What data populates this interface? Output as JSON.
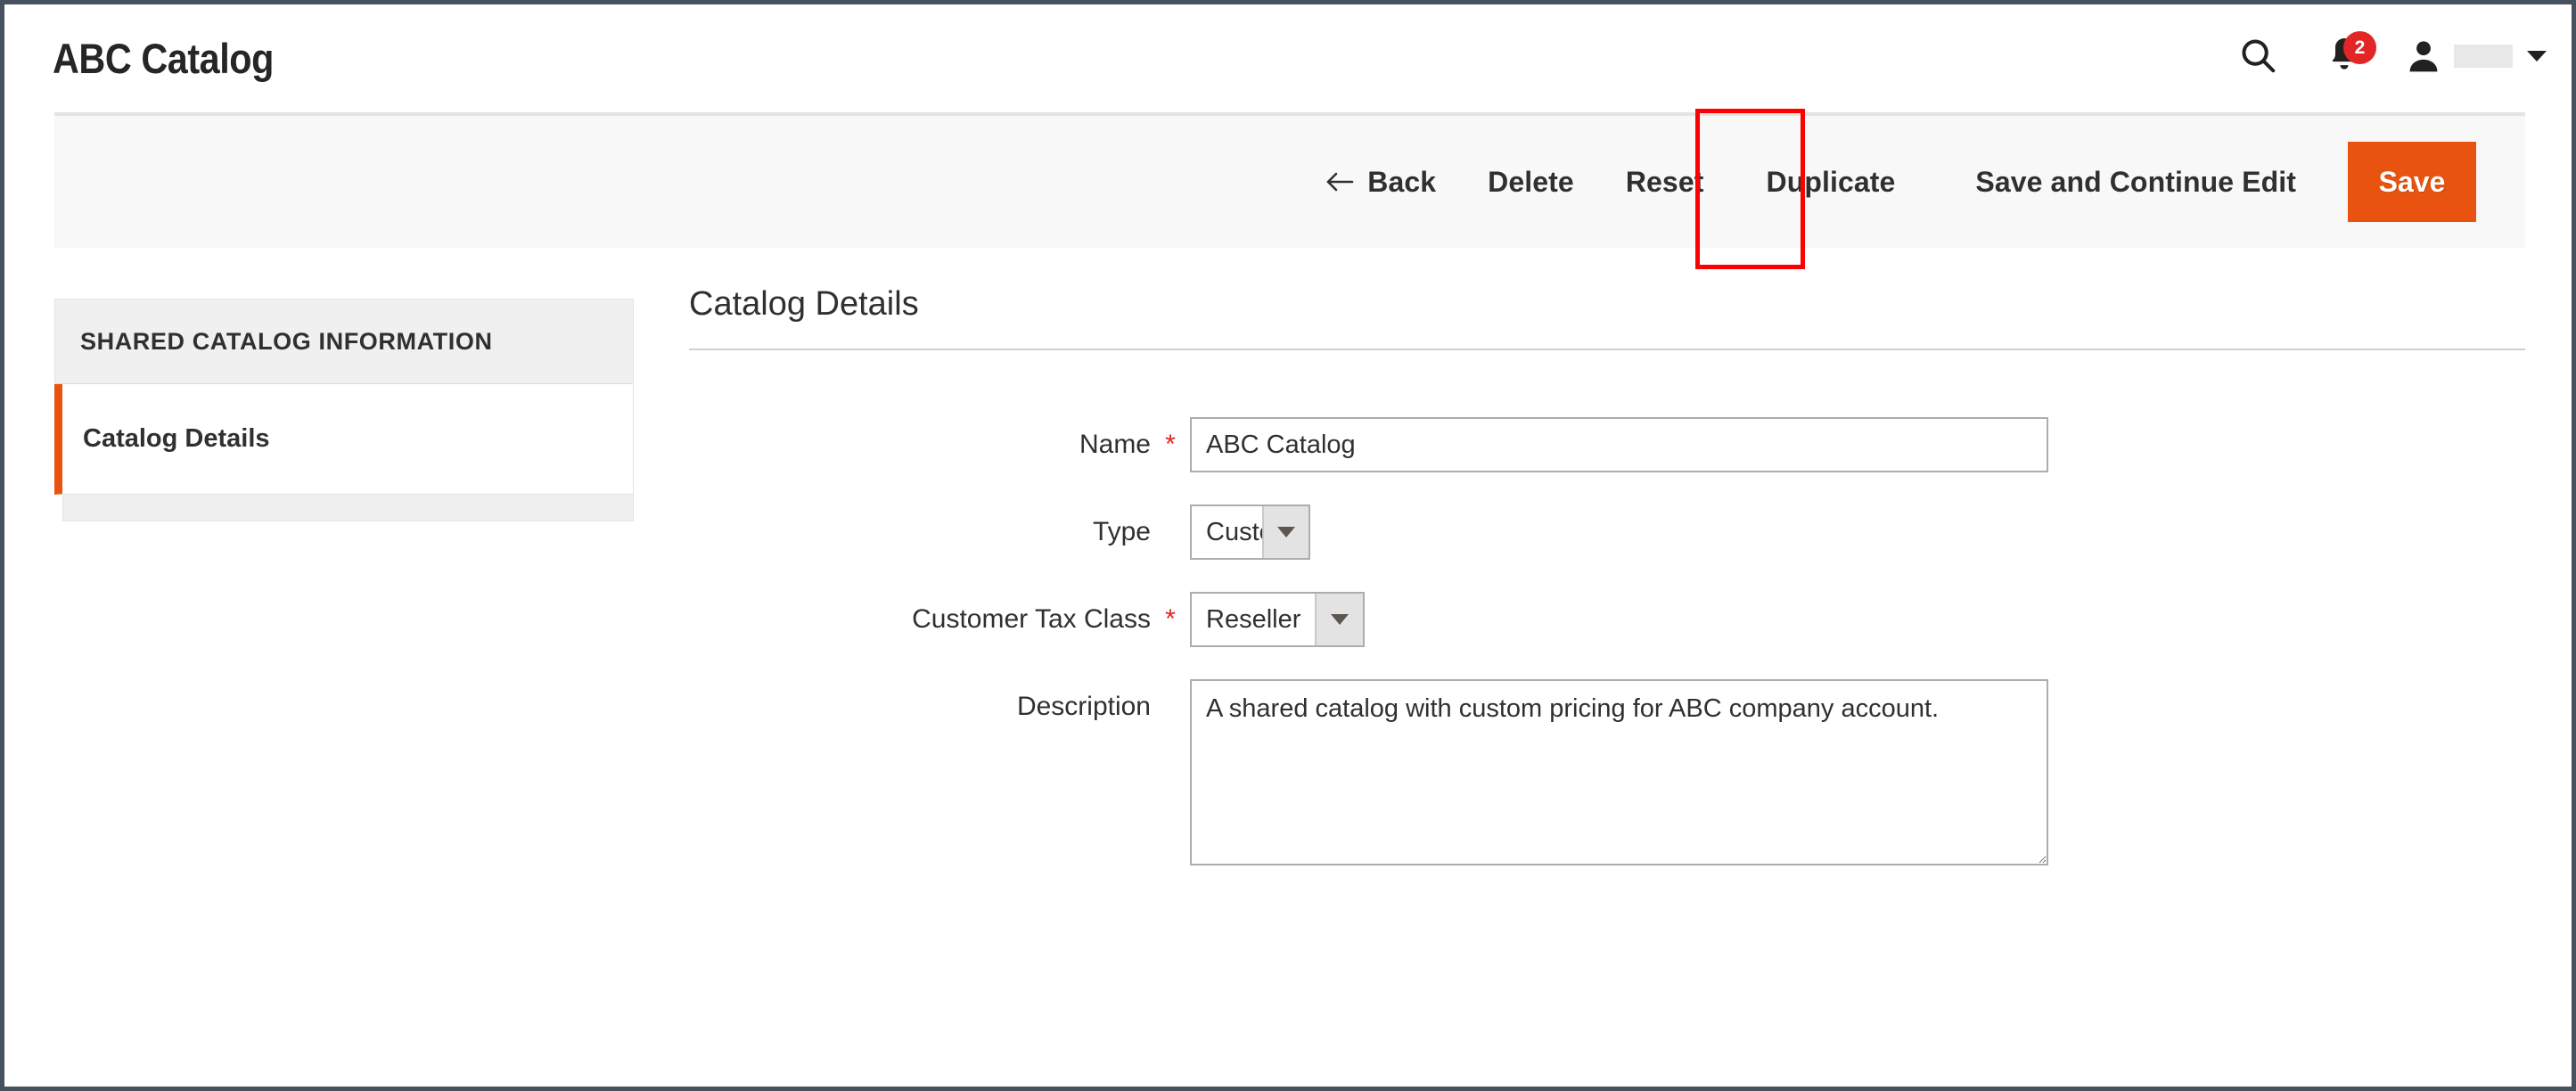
{
  "window": {
    "frame_border_color": "#46535e"
  },
  "header": {
    "page_title": "ABC Catalog",
    "search_icon": "search-icon",
    "notifications_icon": "bell-icon",
    "notifications_count": "2",
    "notifications_badge_color": "#e22626",
    "account_icon": "user-avatar-icon",
    "account_name": "",
    "account_chevron_icon": "chevron-down-icon"
  },
  "toolbar": {
    "back_label": "Back",
    "back_icon": "arrow-left-icon",
    "delete_label": "Delete",
    "reset_label": "Reset",
    "duplicate_label": "Duplicate",
    "save_and_continue_label": "Save and Continue Edit",
    "save_label": "Save",
    "save_button_color": "#e8530f",
    "highlight_target": "Duplicate",
    "highlight_color": "#ff0000"
  },
  "sidebar": {
    "section_title": "SHARED CATALOG INFORMATION",
    "items": [
      {
        "label": "Catalog Details",
        "active": true,
        "accent_color": "#e8530f"
      }
    ]
  },
  "form": {
    "heading": "Catalog Details",
    "fields": [
      {
        "label": "Name",
        "required": true,
        "required_marker": "*",
        "type": "text",
        "value": "ABC Catalog",
        "placeholder": ""
      },
      {
        "label": "Type",
        "required": false,
        "required_marker": "",
        "type": "select",
        "value": "Custom"
      },
      {
        "label": "Customer Tax Class",
        "required": true,
        "required_marker": "*",
        "type": "select",
        "value": "Reseller"
      },
      {
        "label": "Description",
        "required": false,
        "required_marker": "",
        "type": "textarea",
        "value": "A shared catalog with custom pricing for ABC company account.",
        "placeholder": ""
      }
    ]
  }
}
